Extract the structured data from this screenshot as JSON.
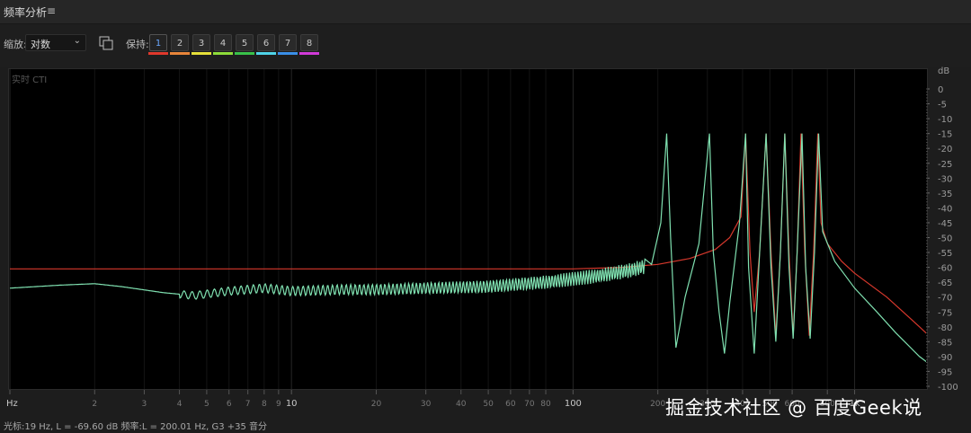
{
  "panel": {
    "title": "频率分析",
    "menu_icon": "hamburger-menu-icon"
  },
  "toolbar": {
    "scale_label": "缩放:",
    "scale_value": "对数",
    "hold_label": "保持:",
    "hold_buttons": [
      {
        "label": "1",
        "color": "#e0382c"
      },
      {
        "label": "2",
        "color": "#e8853a"
      },
      {
        "label": "3",
        "color": "#e6e03a"
      },
      {
        "label": "4",
        "color": "#8edc3a"
      },
      {
        "label": "5",
        "color": "#39c24a"
      },
      {
        "label": "6",
        "color": "#4fd3e8"
      },
      {
        "label": "7",
        "color": "#3a8fe8"
      },
      {
        "label": "8",
        "color": "#d13ad8"
      }
    ]
  },
  "plot": {
    "caption": "实时 CTI"
  },
  "status": {
    "text": "光标:19 Hz, L = -69.60 dB 频率:L = 200.01 Hz, G3 +35 音分"
  },
  "watermark": "掘金技术社区 @ 百度Geek说",
  "chart_data": {
    "type": "line",
    "x_scale": "log",
    "xlim": [
      1,
      3000
    ],
    "ylim": [
      -100,
      0
    ],
    "xlabel": "Hz",
    "ylabel": "dB",
    "x_ticks": [
      {
        "v": 1,
        "label": "Hz"
      },
      {
        "v": 2,
        "label": "2"
      },
      {
        "v": 3,
        "label": "3"
      },
      {
        "v": 4,
        "label": "4"
      },
      {
        "v": 5,
        "label": "5"
      },
      {
        "v": 6,
        "label": "6"
      },
      {
        "v": 7,
        "label": "7"
      },
      {
        "v": 8,
        "label": "8"
      },
      {
        "v": 9,
        "label": "9"
      },
      {
        "v": 10,
        "label": "10"
      },
      {
        "v": 20,
        "label": "20"
      },
      {
        "v": 30,
        "label": "30"
      },
      {
        "v": 40,
        "label": "40"
      },
      {
        "v": 50,
        "label": "50"
      },
      {
        "v": 60,
        "label": "60"
      },
      {
        "v": 70,
        "label": "70"
      },
      {
        "v": 80,
        "label": "80"
      },
      {
        "v": 100,
        "label": "100"
      },
      {
        "v": 200,
        "label": "200"
      },
      {
        "v": 300,
        "label": "300"
      },
      {
        "v": 400,
        "label": "400"
      },
      {
        "v": 500,
        "label": "500"
      },
      {
        "v": 600,
        "label": "600"
      },
      {
        "v": 800,
        "label": "800"
      },
      {
        "v": 1000,
        "label": "1k"
      }
    ],
    "y_ticks": [
      "dB",
      "0",
      "-5",
      "-10",
      "-15",
      "-20",
      "-25",
      "-30",
      "-35",
      "-40",
      "-45",
      "-50",
      "-55",
      "-60",
      "-65",
      "-70",
      "-75",
      "-80",
      "-85",
      "-90",
      "-95",
      "-100"
    ],
    "series": [
      {
        "color": "#d6382c",
        "points": [
          [
            1,
            -60.5
          ],
          [
            100,
            -60.5
          ],
          [
            150,
            -60
          ],
          [
            200,
            -59
          ],
          [
            260,
            -57
          ],
          [
            320,
            -54
          ],
          [
            360,
            -50
          ],
          [
            395,
            -43
          ],
          [
            410,
            -15
          ],
          [
            425,
            -55
          ],
          [
            440,
            -75
          ],
          [
            460,
            -55
          ],
          [
            485,
            -15
          ],
          [
            505,
            -55
          ],
          [
            525,
            -83
          ],
          [
            545,
            -55
          ],
          [
            565,
            -15
          ],
          [
            585,
            -55
          ],
          [
            605,
            -83
          ],
          [
            625,
            -55
          ],
          [
            645,
            -15
          ],
          [
            665,
            -55
          ],
          [
            690,
            -83
          ],
          [
            715,
            -55
          ],
          [
            740,
            -15
          ],
          [
            760,
            -45
          ],
          [
            800,
            -52
          ],
          [
            900,
            -58
          ],
          [
            1000,
            -62
          ],
          [
            1300,
            -70
          ],
          [
            1700,
            -80
          ],
          [
            2200,
            -90
          ],
          [
            2700,
            -99
          ]
        ]
      },
      {
        "color": "#7fe0b0",
        "points": [
          [
            1,
            -67
          ],
          [
            1.5,
            -66
          ],
          [
            2,
            -65.5
          ],
          [
            2.5,
            -66.5
          ],
          [
            3.5,
            -68.5
          ],
          [
            4.5,
            -69.5
          ],
          [
            6,
            -68
          ],
          [
            8,
            -67
          ],
          [
            10,
            -68
          ],
          [
            15,
            -67.5
          ],
          [
            20,
            -67.5
          ],
          [
            30,
            -67
          ],
          [
            50,
            -66.5
          ],
          [
            80,
            -65
          ],
          [
            120,
            -63
          ],
          [
            160,
            -61
          ],
          [
            190,
            -59
          ],
          [
            205,
            -45
          ],
          [
            215,
            -15
          ],
          [
            222,
            -50
          ],
          [
            232,
            -87
          ],
          [
            250,
            -70
          ],
          [
            280,
            -52
          ],
          [
            305,
            -15
          ],
          [
            315,
            -55
          ],
          [
            330,
            -75
          ],
          [
            345,
            -89
          ],
          [
            360,
            -72
          ],
          [
            390,
            -45
          ],
          [
            410,
            -15
          ],
          [
            420,
            -60
          ],
          [
            440,
            -89
          ],
          [
            460,
            -55
          ],
          [
            485,
            -15
          ],
          [
            505,
            -60
          ],
          [
            525,
            -85
          ],
          [
            545,
            -55
          ],
          [
            565,
            -15
          ],
          [
            585,
            -60
          ],
          [
            605,
            -84
          ],
          [
            625,
            -55
          ],
          [
            650,
            -15
          ],
          [
            670,
            -60
          ],
          [
            695,
            -84
          ],
          [
            720,
            -55
          ],
          [
            745,
            -15
          ],
          [
            770,
            -48
          ],
          [
            850,
            -58
          ],
          [
            1000,
            -67
          ],
          [
            1200,
            -75
          ],
          [
            1400,
            -82
          ],
          [
            1700,
            -90
          ],
          [
            2000,
            -95
          ],
          [
            2300,
            -100
          ]
        ]
      }
    ],
    "ripple": {
      "series_index": 1,
      "from": 4,
      "to": 180,
      "amplitude_db": 2.5,
      "cycles_per_decade": 28
    }
  }
}
